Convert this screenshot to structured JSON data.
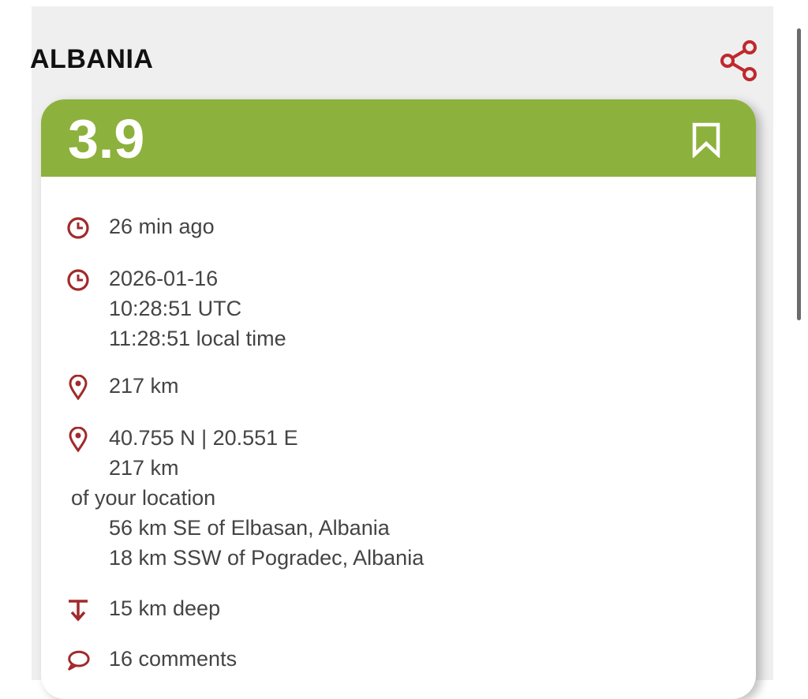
{
  "header": {
    "title": "ALBANIA",
    "share_icon": "share-icon"
  },
  "event": {
    "magnitude": "3.9",
    "magnitude_color": "#8db13d",
    "bookmark_icon": "bookmark-icon",
    "relative_time": "26 min ago",
    "date": "2026-01-16",
    "utc_time": "10:28:51 UTC",
    "local_time": "11:28:51 local time",
    "distance": "217 km",
    "coordinates": "40.755 N | 20.551 E",
    "distance_repeat": "217 km",
    "distance_note": "of your location",
    "nearby": [
      "56 km SE of Elbasan, Albania",
      "18 km SSW of Pogradec, Albania"
    ],
    "depth": "15 km deep",
    "comments": "16 comments"
  },
  "accent_color": "#a12a2a"
}
